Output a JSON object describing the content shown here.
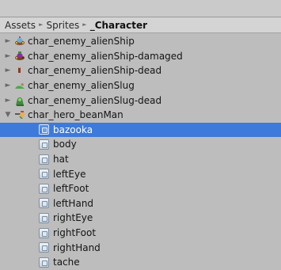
{
  "breadcrumb": {
    "items": [
      "Assets",
      "Sprites",
      "_Character"
    ],
    "separator": "►"
  },
  "tree": {
    "collapsed_arrow": "►",
    "expanded_arrow": "▼",
    "items": [
      {
        "label": "char_enemy_alienShip",
        "icon": "alien-ship-icon",
        "expanded": false
      },
      {
        "label": "char_enemy_alienShip-damaged",
        "icon": "alien-ship-damaged-icon",
        "expanded": false
      },
      {
        "label": "char_enemy_alienShip-dead",
        "icon": "alien-ship-dead-icon",
        "expanded": false
      },
      {
        "label": "char_enemy_alienSlug",
        "icon": "alien-slug-icon",
        "expanded": false
      },
      {
        "label": "char_enemy_alienSlug-dead",
        "icon": "alien-slug-dead-icon",
        "expanded": false
      },
      {
        "label": "char_hero_beanMan",
        "icon": "bean-man-icon",
        "expanded": true,
        "children": [
          "bazooka",
          "body",
          "hat",
          "leftEye",
          "leftFoot",
          "leftHand",
          "rightEye",
          "rightFoot",
          "rightHand",
          "tache"
        ]
      }
    ],
    "selected_child": "bazooka"
  },
  "colors": {
    "selection": "#3d7ad9",
    "background": "#bdbdbd",
    "breadcrumb_bar": "#d4d4d4"
  }
}
